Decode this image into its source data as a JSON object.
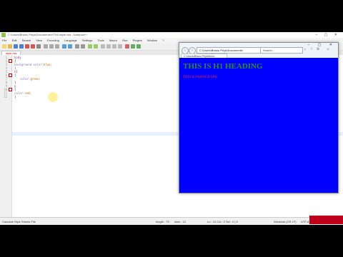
{
  "window_title": "C:\\Users\\Bhanu Priya\\Documents\\HTML\\style.css - Notepad++",
  "window_controls": "– ▢ ✕",
  "menu": [
    "File",
    "Edit",
    "Search",
    "View",
    "Encoding",
    "Language",
    "Settings",
    "Tools",
    "Macro",
    "Run",
    "Plugins",
    "Window",
    "?"
  ],
  "tab_label": "style.css",
  "line_numbers": [
    "1",
    "2",
    "3",
    "4",
    "5",
    "6",
    "7",
    "8",
    "9",
    "10",
    "11",
    "12"
  ],
  "code_lines": [
    {
      "sel": "body",
      "prop": "",
      "val": ""
    },
    {
      "sel": "{",
      "prop": "",
      "val": ""
    },
    {
      "sel": "",
      "prop": "background-color:",
      "val": "blue;"
    },
    {
      "sel": "}",
      "prop": "",
      "val": ""
    },
    {
      "sel": "h1",
      "prop": "",
      "val": ""
    },
    {
      "sel": "{",
      "prop": "",
      "val": ""
    },
    {
      "sel": "",
      "prop": "color:",
      "val": "green;"
    },
    {
      "sel": "}",
      "prop": "",
      "val": ""
    },
    {
      "sel": "p",
      "prop": "",
      "val": ""
    },
    {
      "sel": "{",
      "prop": "",
      "val": ""
    },
    {
      "sel": "",
      "prop": "color:",
      "val": "red;"
    },
    {
      "sel": "}",
      "prop": "",
      "val": ""
    }
  ],
  "statusbar": {
    "type": "Cascade Style Sheets File",
    "length": "length : 79",
    "lines": "lines : 12",
    "position": "Ln : 12   Col : 2   Sel : 0 | 0",
    "eol": "Windows (CR LF)",
    "encoding": "UTF-8",
    "mode": "INS"
  },
  "browser": {
    "address": "C:\\Users\\Bhanu Priya\\Documents\\",
    "search_placeholder": "Search...",
    "tab_title": "C:\\Users\\Bhanu Priya\\Docu...",
    "controls": "– ▢ ✕",
    "heading": "THIS IS H1 HEADING",
    "paragraph": "THIS IS PARAGRAPH",
    "colors": {
      "background": "#0000fe",
      "heading": "#2d8a2d",
      "paragraph": "#ff2020"
    }
  },
  "icons": [
    "back-icon",
    "forward-icon",
    "refresh-icon",
    "search-icon",
    "home-icon",
    "star-icon",
    "settings-icon"
  ]
}
